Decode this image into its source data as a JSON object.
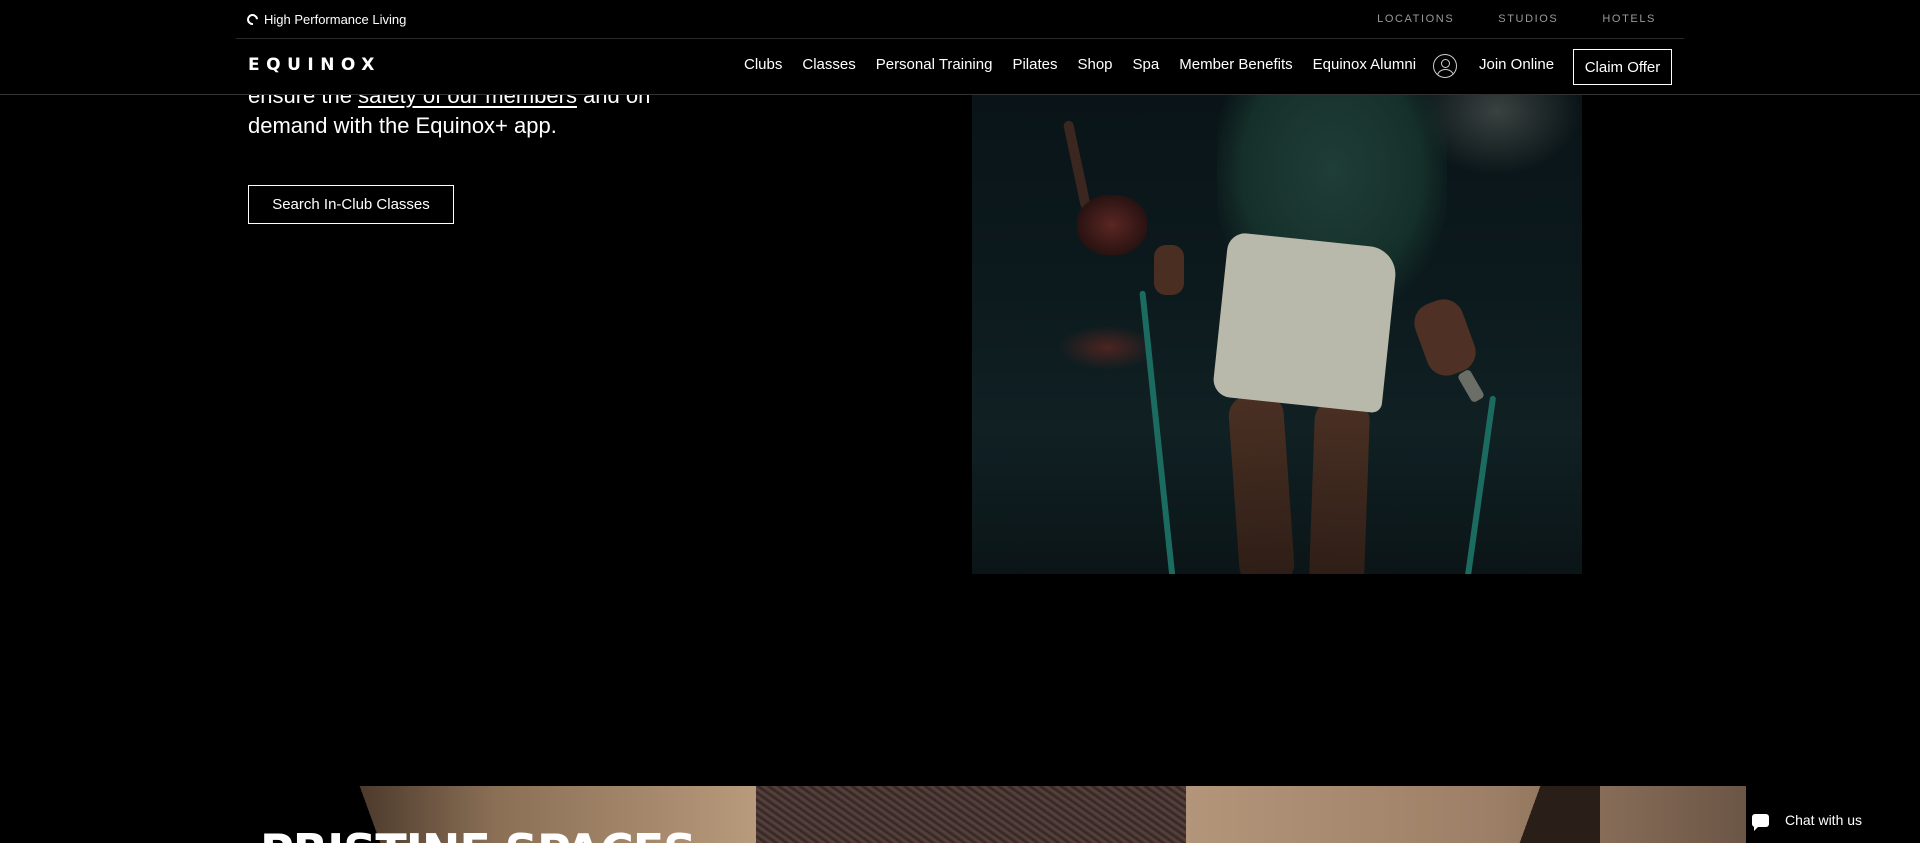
{
  "utility_bar": {
    "tagline": "High Performance Living",
    "links": [
      "LOCATIONS",
      "STUDIOS",
      "HOTELS"
    ]
  },
  "nav": {
    "logo": "EQUINOX",
    "links": [
      "Clubs",
      "Classes",
      "Personal Training",
      "Pilates",
      "Shop",
      "Spa",
      "Member Benefits",
      "Equinox Alumni"
    ],
    "join_online": "Join Online",
    "claim_offer": "Claim Offer"
  },
  "hero": {
    "text_before": "ensure the ",
    "link_text": "safety of our members",
    "text_after": " and on demand with the Equinox+ app.",
    "search_button": "Search In-Club Classes"
  },
  "bottom": {
    "heading": "PRISTINE SPACES"
  },
  "chat": {
    "label": "Chat with us"
  }
}
